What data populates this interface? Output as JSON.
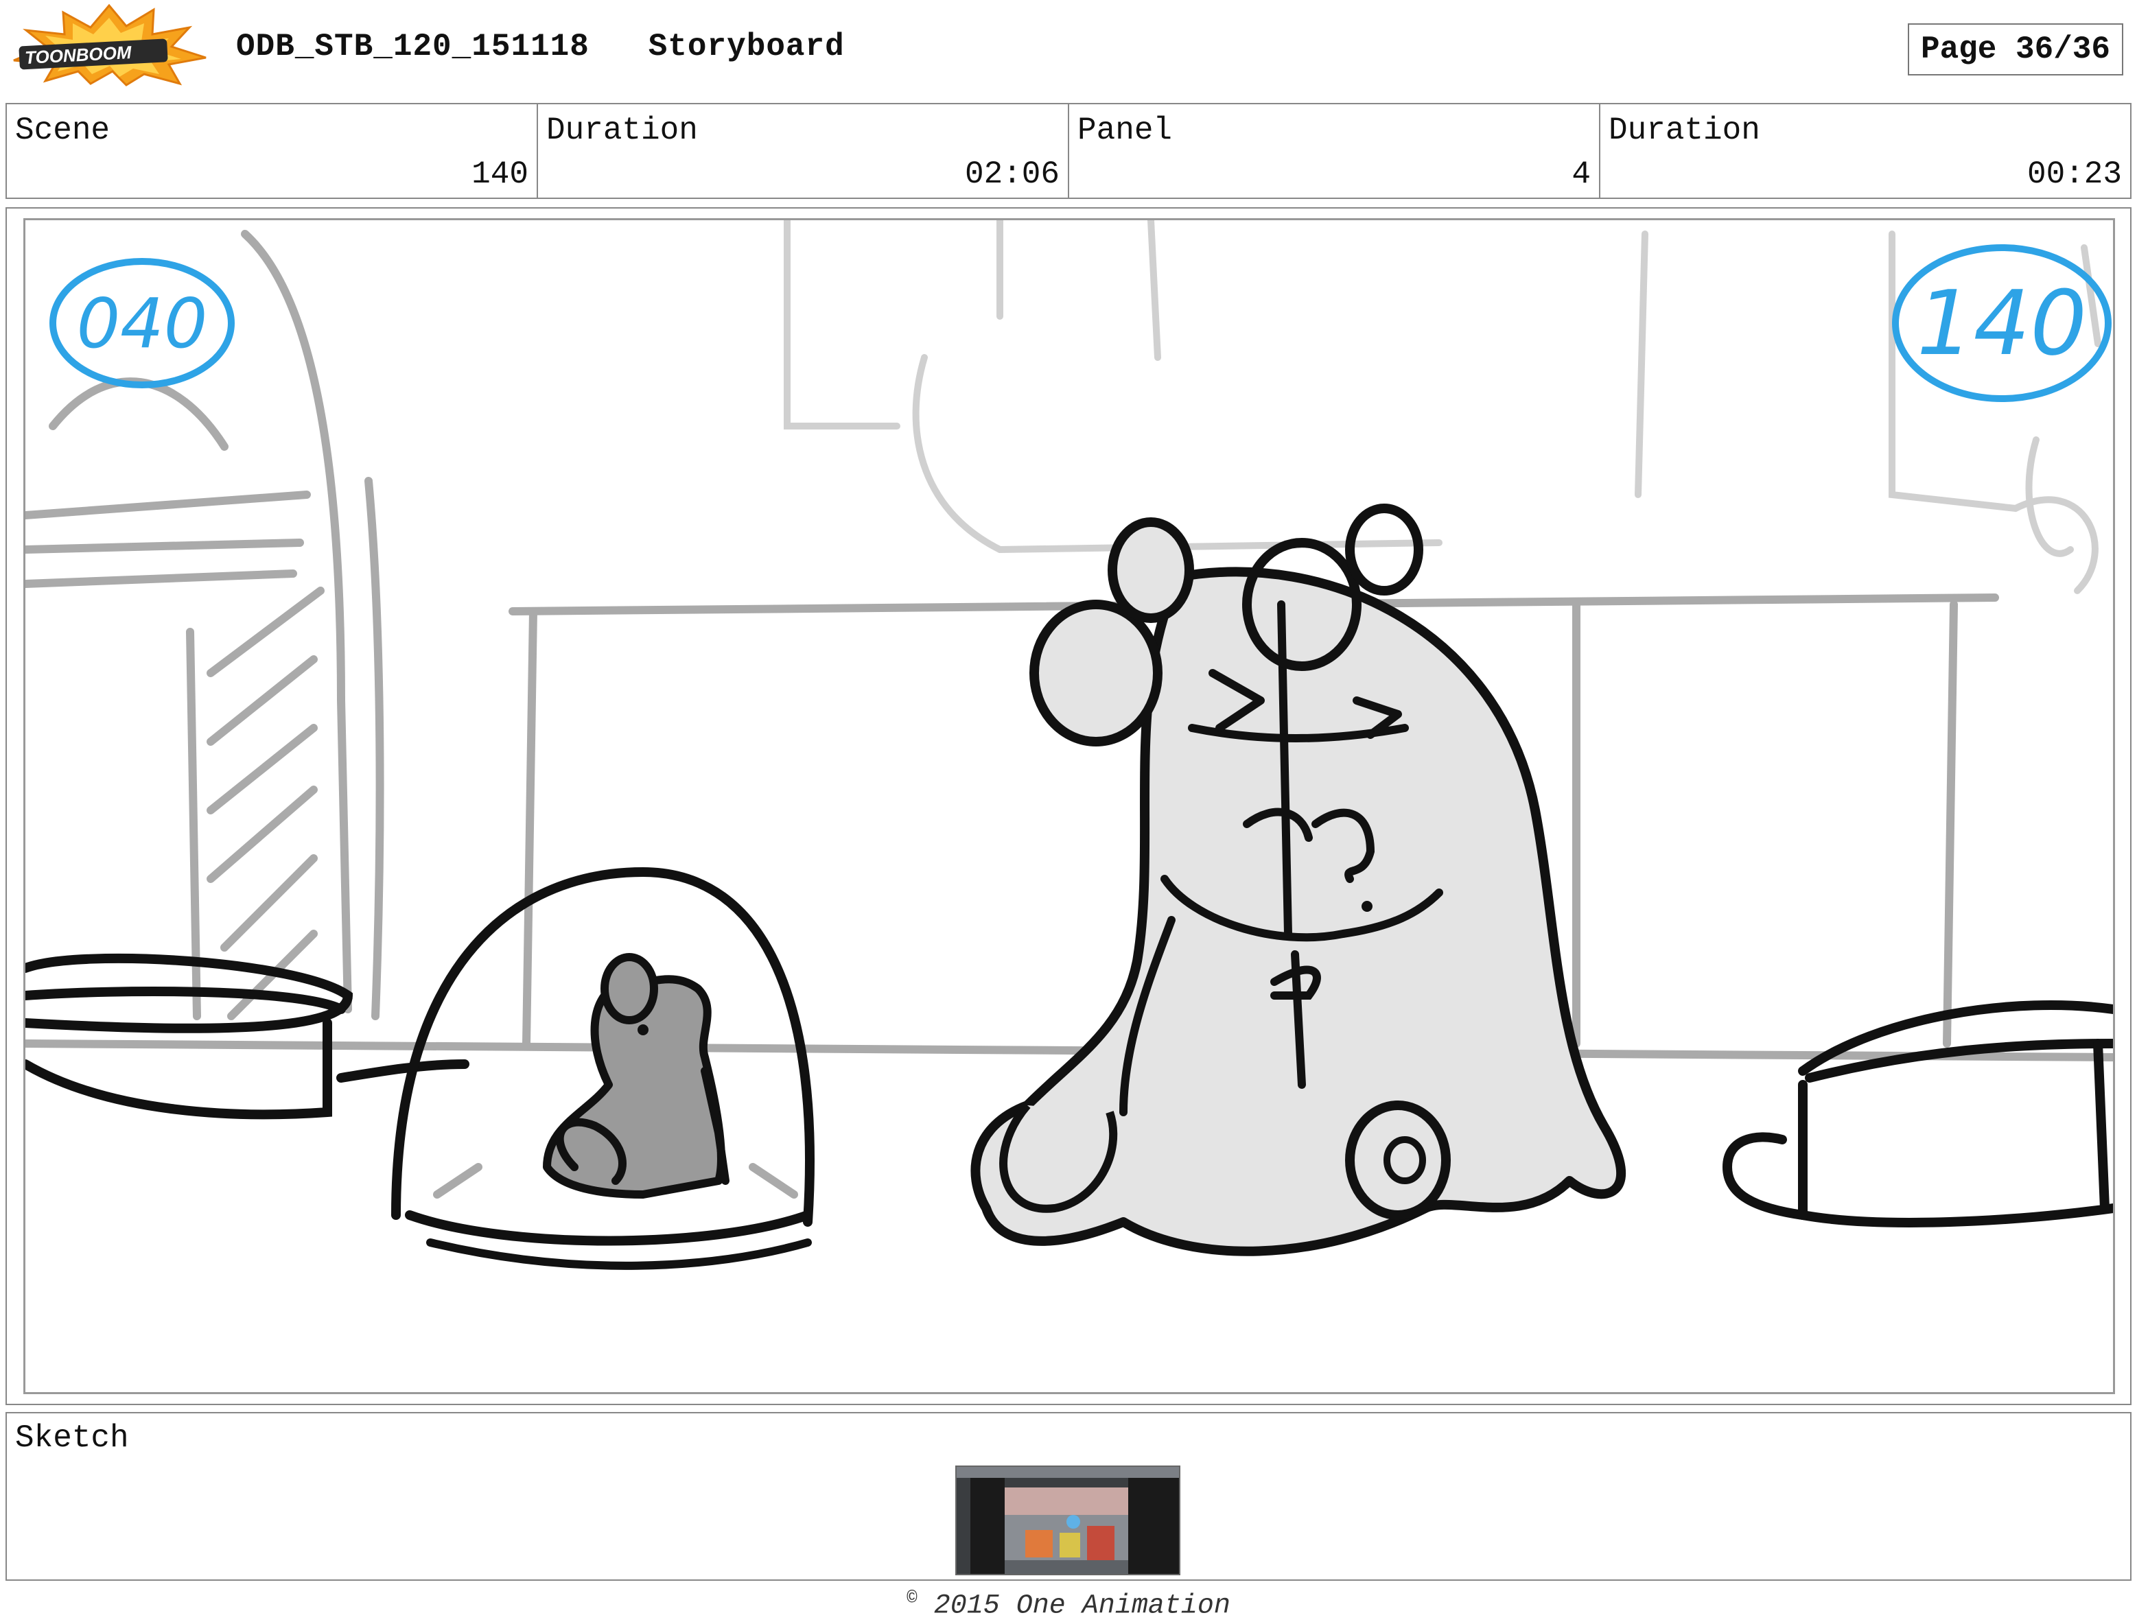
{
  "header": {
    "logo_text": "TOONBOOM",
    "title": "ODB_STB_120_151118   Storyboard",
    "page": "Page 36/36"
  },
  "info": {
    "scene_label": "Scene",
    "scene_value": "140",
    "scene_duration_label": "Duration",
    "scene_duration_value": "02:06",
    "panel_label": "Panel",
    "panel_value": "4",
    "panel_duration_label": "Duration",
    "panel_duration_value": "00:23"
  },
  "panel": {
    "left_mark": "040",
    "right_mark": "140",
    "mark_color": "#2ea3e6",
    "line_color": "#111111",
    "background_line_color": "#aaaaaa",
    "fill_light": "#e4e4e4",
    "fill_dark": "#9a9a9a"
  },
  "sketch": {
    "label": "Sketch"
  },
  "footer": {
    "copyright_symbol": "©",
    "text": " 2015 One Animation"
  }
}
